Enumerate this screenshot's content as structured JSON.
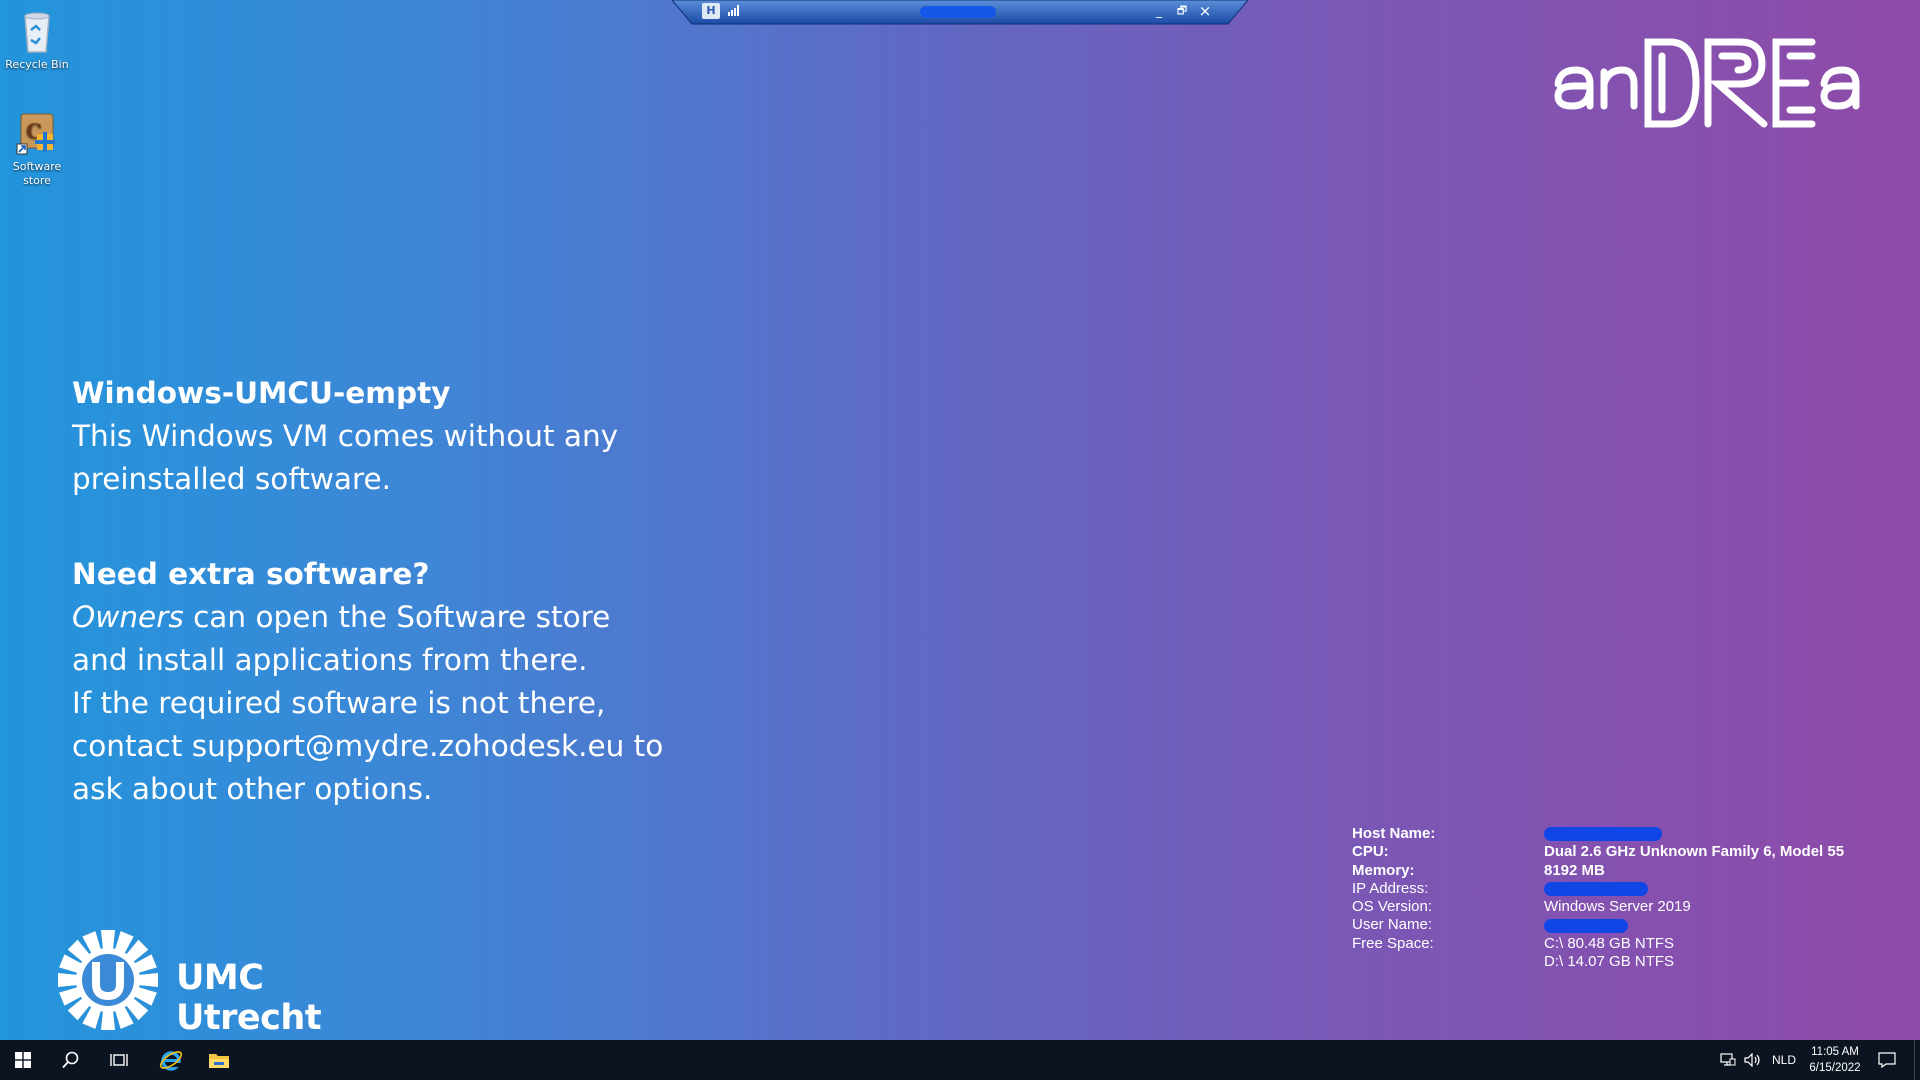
{
  "desktop": {
    "icons": [
      {
        "label": "Recycle Bin"
      },
      {
        "label": "Software store"
      }
    ]
  },
  "rdp_bar": {
    "pin_glyph": "H",
    "buttons": {
      "minimize": "_",
      "restore": "🗗",
      "close": "×"
    }
  },
  "brand": {
    "logo_text": "anDREa",
    "org_name": "UMC Utrecht"
  },
  "info": {
    "title": "Windows-UMCU-empty",
    "line1": "This Windows VM comes without any",
    "line2": "preinstalled software.",
    "heading2": "Need extra software?",
    "owners": "Owners",
    "line3": " can open the Software store",
    "line4": "and install applications from there.",
    "line5": "If the required software is not there,",
    "line6": "contact support@mydre.zohodesk.eu to",
    "line7": "ask about other options."
  },
  "sysinfo": {
    "host_label": "Host Name:",
    "cpu_label": "CPU:",
    "cpu_value": "Dual 2.6 GHz Unknown Family 6, Model 55",
    "memory_label": "Memory:",
    "memory_value": "8192 MB",
    "ip_label": "IP Address:",
    "os_label": "OS Version:",
    "os_value": "Windows Server 2019",
    "user_label": "User Name:",
    "free_label": "Free Space:",
    "free_c": "C:\\ 80.48 GB NTFS",
    "free_d": "D:\\ 14.07 GB NTFS"
  },
  "taskbar": {
    "language": "NLD",
    "time": "11:05 AM",
    "date": "6/15/2022"
  },
  "colors": {
    "gradient_left": "#2295dc",
    "gradient_right": "#8f4aa8",
    "redaction": "#1046e6",
    "taskbar": "#0c1421"
  }
}
